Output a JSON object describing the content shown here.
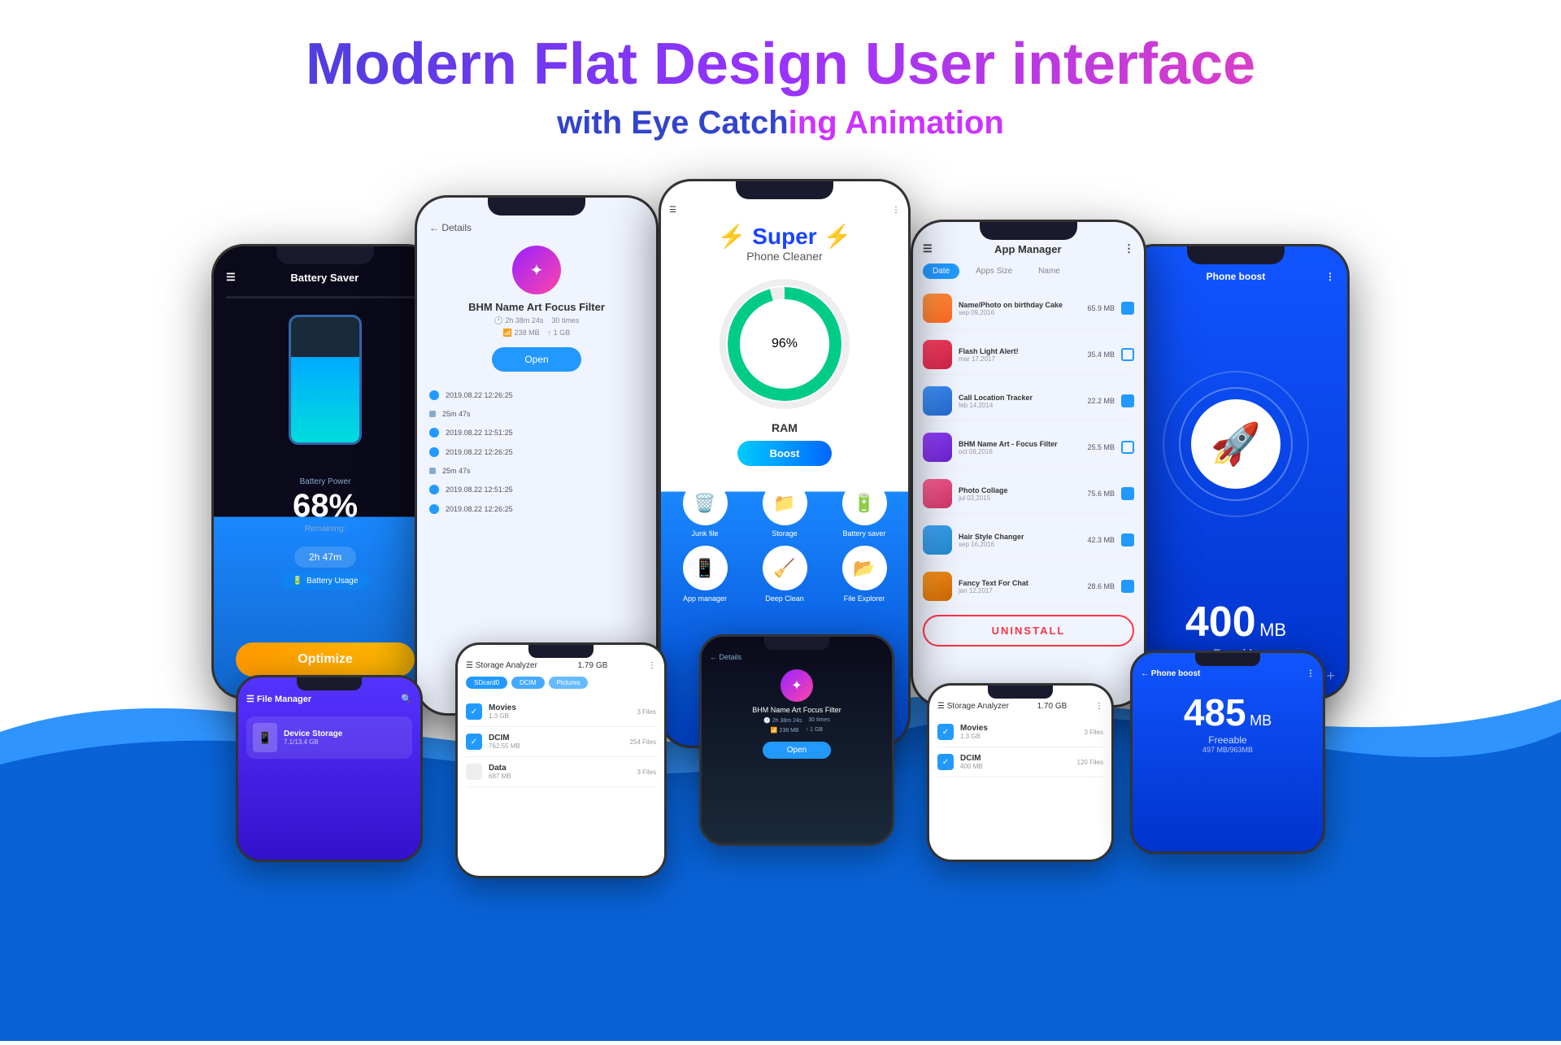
{
  "header": {
    "title": "Modern Flat Design User interface",
    "subtitle_start": "with Eye Catch",
    "subtitle_highlight": "ing Animation"
  },
  "phone1": {
    "title": "Battery Saver",
    "battery_power": "Battery Power",
    "percent": "68%",
    "remaining": "Remaining:",
    "time": "2h 47m",
    "battery_usage": "Battery Usage",
    "optimize": "Optimize"
  },
  "phone2": {
    "back": "< Details",
    "app_name": "BHM Name Art Focus Filter",
    "stats": "2h 38m 24s  30 times",
    "data": "238 MB    1 GB",
    "open": "Open",
    "timeline_dates": [
      "2019.08.22 12:26:25",
      "25m 47s",
      "2019.08.22 12:51:25",
      "2019.08.22 12:26:25",
      "25m 47s",
      "2019.08.22 12:51:25",
      "2019.08.22 12:26:25"
    ]
  },
  "phone3": {
    "title_lightning": "⚡",
    "title_super": "Super",
    "title_sub": "Phone Cleaner",
    "percent": "96%",
    "ram": "RAM",
    "boost": "Boost",
    "icons": [
      {
        "label": "Junk file",
        "icon": "🗑️"
      },
      {
        "label": "Storage",
        "icon": "📁"
      },
      {
        "label": "Battery saver",
        "icon": "🔋"
      },
      {
        "label": "App manager",
        "icon": "📱"
      },
      {
        "label": "Deep Clean",
        "icon": "🧹"
      },
      {
        "label": "File Explorer",
        "icon": "📂"
      }
    ]
  },
  "phone4": {
    "title": "App Manager",
    "tabs": [
      "Date",
      "Apps Size",
      "Name"
    ],
    "apps": [
      {
        "name": "Name/Photo on birthday Cake",
        "date": "sep 09,2016",
        "size": "65.9 MB",
        "checked": true
      },
      {
        "name": "Flash Light Alert!",
        "date": "mar 17,2017",
        "size": "35.4 MB",
        "checked": false
      },
      {
        "name": "Call Location Tracker",
        "date": "feb 14,2014",
        "size": "22.2 MB",
        "checked": true
      },
      {
        "name": "BHM Name Art - Focus Filter",
        "date": "oct 09,2016",
        "size": "25.5 MB",
        "checked": false
      },
      {
        "name": "Photo Collage",
        "date": "jul 03,2015",
        "size": "75.6 MB",
        "checked": true
      },
      {
        "name": "Hair Style Changer",
        "date": "sep 16,2016",
        "size": "42.3 MB",
        "checked": true
      },
      {
        "name": "Fancy Text For Chat",
        "date": "jan 12,2017",
        "size": "28.6 MB",
        "checked": true
      }
    ],
    "uninstall": "UNINSTALL"
  },
  "phone5": {
    "title": "Phone boost",
    "mb": "400",
    "unit": "MB",
    "label": "Freeable"
  },
  "phone_bottom_left": {
    "title": "File Manager",
    "file_name": "Device Storage",
    "file_size": "7.1/13.4 GB"
  },
  "phone_storage": {
    "title": "Storage Analyzer",
    "size": "1.79 GB",
    "items": [
      {
        "name": "Movies",
        "size": "1.3 GB",
        "count": "3 Files"
      },
      {
        "name": "DCIM",
        "size": "762.55 MB",
        "count": "254 Files"
      },
      {
        "name": "Data",
        "size": "687 MB",
        "count": "3 Files"
      }
    ],
    "breadcrumbs": [
      "SDcard0",
      "DCIM",
      "Pictures"
    ]
  },
  "phone_boost_bottom": {
    "title": "Phone boost",
    "mb": "485",
    "unit": "MB",
    "label": "Freeable",
    "sub": "497 MB/963MB"
  }
}
